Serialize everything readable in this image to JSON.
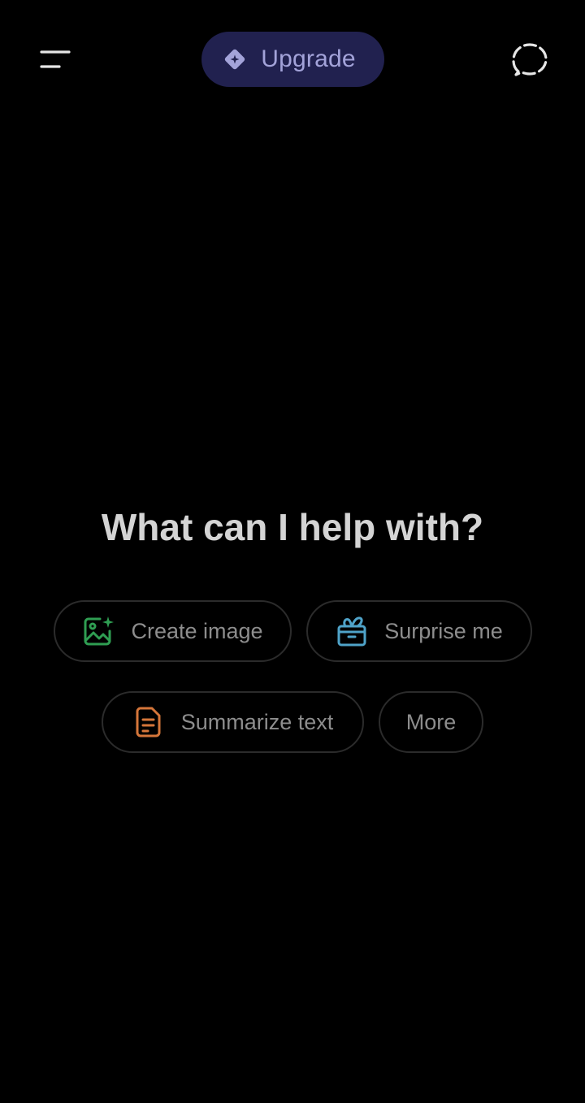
{
  "header": {
    "menu_icon": "hamburger-menu-icon",
    "upgrade": {
      "label": "Upgrade",
      "icon": "sparkle-diamond-icon",
      "background": "#21214f",
      "text_color": "#a3a3d9"
    },
    "new_chat_icon": "dashed-chat-bubble-icon"
  },
  "main": {
    "headline": "What can I help with?",
    "suggestions": [
      {
        "label": "Create image",
        "icon": "image-sparkle-icon",
        "icon_color": "#2f9e52"
      },
      {
        "label": "Surprise me",
        "icon": "gift-box-icon",
        "icon_color": "#4fa3c9"
      },
      {
        "label": "Summarize text",
        "icon": "document-icon",
        "icon_color": "#d5763a"
      },
      {
        "label": "More"
      }
    ]
  }
}
